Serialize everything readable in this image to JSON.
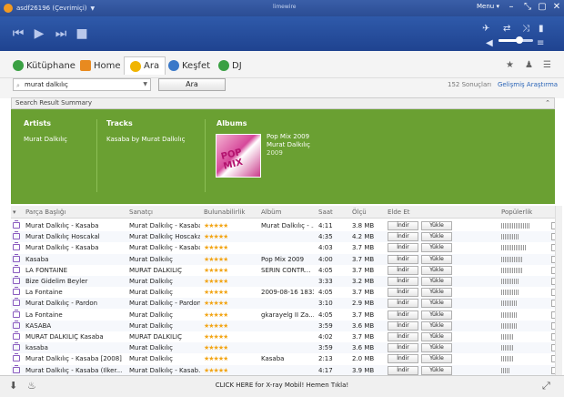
{
  "titlebar": {
    "status": "asdf26196 (Çevrimiçi)",
    "window_title": "limewire",
    "menu_label": "Menu ▾"
  },
  "nav": {
    "tabs": [
      {
        "label": "Kütüphane",
        "icon": "library-icon",
        "color": "#3aa043"
      },
      {
        "label": "Home",
        "icon": "home-icon",
        "color": "#e88a1f"
      },
      {
        "label": "Ara",
        "icon": "search-icon",
        "color": "#f0b400"
      },
      {
        "label": "Keşfet",
        "icon": "discover-icon",
        "color": "#3a78c8"
      },
      {
        "label": "DJ",
        "icon": "dj-icon",
        "color": "#3aa043"
      }
    ]
  },
  "search": {
    "value": "murat dalkılıç",
    "button_label": "Ara",
    "result_count": "152 Sonuçları",
    "advanced_label": "Gelişmiş Araştırma"
  },
  "summary": {
    "header": "Search Result Summary",
    "artists_title": "Artists",
    "artist": "Murat Dalkılıç",
    "tracks_title": "Tracks",
    "track": "Kasaba by Murat Dalkılıç",
    "albums_title": "Albums",
    "album": {
      "title": "Pop Mix 2009",
      "artist": "Murat Dalkılıç",
      "year": "2009",
      "art_text": "POP MIX"
    }
  },
  "table": {
    "headers": {
      "title": "Parça Başlığı",
      "artist": "Sanatçı",
      "availability": "Bulunabilirlik",
      "album": "Albüm",
      "time": "Saat",
      "size": "Ölçü",
      "get": "Elde Et",
      "popularity": "Popülerlik"
    },
    "download_label": "İndir",
    "upload_label": "Yükle",
    "rows": [
      {
        "title": "Murat Dalkılıç - Kasaba",
        "artist": "Murat Dalkılıç - Kasaba",
        "album": "Murat Dalkılıç - ...",
        "time": "4:11",
        "size": "3.8 MB",
        "pop": 0.9
      },
      {
        "title": "Murat Dalkılıç Hoscakal",
        "artist": "Murat Dalkılıç Hoscakal",
        "album": "",
        "time": "4:35",
        "size": "4.2 MB",
        "pop": 0.6
      },
      {
        "title": "Murat Dalkılıç - Kasaba",
        "artist": "Murat Dalkılıç - Kasaba",
        "album": "",
        "time": "4:03",
        "size": "3.7 MB",
        "pop": 0.8
      },
      {
        "title": "Kasaba",
        "artist": "Murat Dalkılıç",
        "album": "Pop Mix 2009",
        "time": "4:00",
        "size": "3.7 MB",
        "pop": 0.7
      },
      {
        "title": "LA FONTAINE",
        "artist": "MURAT DALKILIÇ",
        "album": "SERIN CONTR...",
        "time": "4:05",
        "size": "3.7 MB",
        "pop": 0.7
      },
      {
        "title": "Bize Gidelim Beyler",
        "artist": "Murat Dalkılıç",
        "album": "",
        "time": "3:33",
        "size": "3.2 MB",
        "pop": 0.6
      },
      {
        "title": "La Fontaine",
        "artist": "Murat Dalkılıç",
        "album": "2009-08-16 1833",
        "time": "4:05",
        "size": "3.7 MB",
        "pop": 0.6
      },
      {
        "title": "Murat Dalkılıç - Pardon",
        "artist": "Murat Dalkılıç - Pardon",
        "album": "",
        "time": "3:10",
        "size": "2.9 MB",
        "pop": 0.5
      },
      {
        "title": "La Fontaine",
        "artist": "Murat Dalkılıç",
        "album": "gkarayelg II Za...",
        "time": "4:05",
        "size": "3.7 MB",
        "pop": 0.5
      },
      {
        "title": "KASABA",
        "artist": "Murat Dalkılıç",
        "album": "",
        "time": "3:59",
        "size": "3.6 MB",
        "pop": 0.5
      },
      {
        "title": "MURAT DALKILIÇ Kasaba",
        "artist": "MURAT DALKILIÇ",
        "album": "",
        "time": "4:02",
        "size": "3.7 MB",
        "pop": 0.4
      },
      {
        "title": "kasaba",
        "artist": "Murat Dalkılıç",
        "album": "",
        "time": "3:59",
        "size": "3.6 MB",
        "pop": 0.4
      },
      {
        "title": "Murat Dalkılıç - Kasaba [2008]",
        "artist": "Murat Dalkılıç",
        "album": "Kasaba",
        "time": "2:13",
        "size": "2.0 MB",
        "pop": 0.4
      },
      {
        "title": "Murat Dalkılıç - Kasaba (Ilker...",
        "artist": "Murat Dalkılıç - Kasab...",
        "album": "",
        "time": "4:17",
        "size": "3.9 MB",
        "pop": 0.3
      }
    ]
  },
  "bottom": {
    "message": "CLICK HERE for X-ray Mobil! Hemen Tıkla!"
  },
  "colors": {
    "summary_green": "#6aa032",
    "player_blue": "#2b4d94",
    "star": "#f2a516",
    "link": "#2a64b7"
  }
}
